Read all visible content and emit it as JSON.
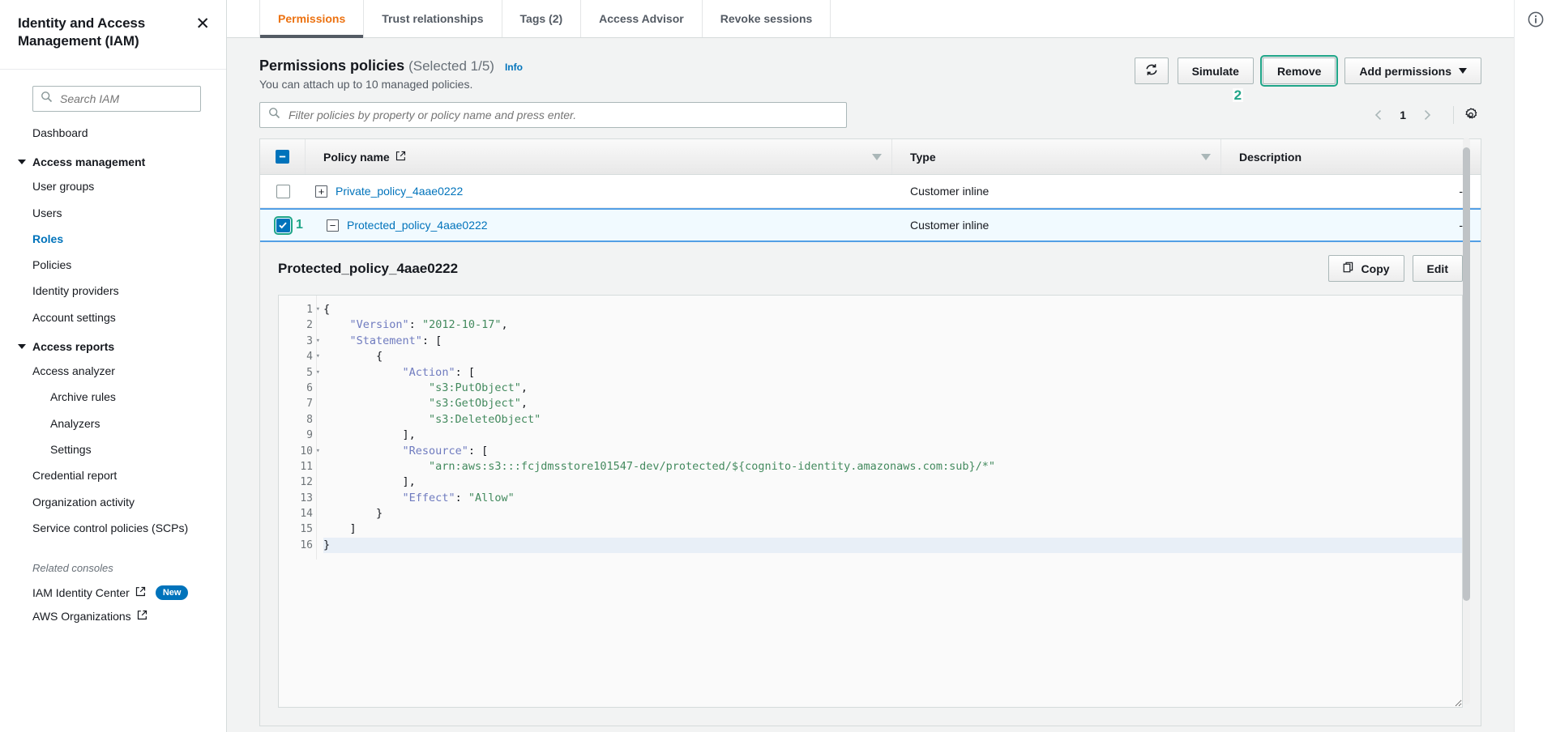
{
  "sidebar": {
    "title": "Identity and Access Management (IAM)",
    "close_label": "✕",
    "search": {
      "placeholder": "Search IAM",
      "value": ""
    },
    "dashboard": "Dashboard",
    "groups": [
      {
        "label": "Access management",
        "items": [
          {
            "label": "User groups",
            "active": false,
            "indent": false
          },
          {
            "label": "Users",
            "active": false,
            "indent": false
          },
          {
            "label": "Roles",
            "active": true,
            "indent": false
          },
          {
            "label": "Policies",
            "active": false,
            "indent": false
          },
          {
            "label": "Identity providers",
            "active": false,
            "indent": false
          },
          {
            "label": "Account settings",
            "active": false,
            "indent": false
          }
        ]
      },
      {
        "label": "Access reports",
        "items": [
          {
            "label": "Access analyzer",
            "active": false,
            "indent": false
          },
          {
            "label": "Archive rules",
            "active": false,
            "indent": true
          },
          {
            "label": "Analyzers",
            "active": false,
            "indent": true
          },
          {
            "label": "Settings",
            "active": false,
            "indent": true
          },
          {
            "label": "Credential report",
            "active": false,
            "indent": false
          },
          {
            "label": "Organization activity",
            "active": false,
            "indent": false
          },
          {
            "label": "Service control policies (SCPs)",
            "active": false,
            "indent": false
          }
        ]
      }
    ],
    "related_label": "Related consoles",
    "related": [
      {
        "label": "IAM Identity Center",
        "badge": "New"
      },
      {
        "label": "AWS Organizations",
        "badge": ""
      }
    ]
  },
  "tabs": [
    {
      "label": "Permissions",
      "active": true
    },
    {
      "label": "Trust relationships",
      "active": false
    },
    {
      "label": "Tags (2)",
      "active": false
    },
    {
      "label": "Access Advisor",
      "active": false
    },
    {
      "label": "Revoke sessions",
      "active": false
    }
  ],
  "panel": {
    "title": "Permissions policies",
    "selected_count": "(Selected 1/5)",
    "info_label": "Info",
    "subtitle": "You can attach up to 10 managed policies.",
    "refresh_icon": "refresh-icon",
    "simulate_label": "Simulate",
    "remove_label": "Remove",
    "add_permissions_label": "Add permissions",
    "step_2": "2"
  },
  "filter": {
    "placeholder": "Filter policies by property or policy name and press enter.",
    "value": ""
  },
  "pagination": {
    "page": "1",
    "prev_icon": "chevron-left-icon",
    "next_icon": "chevron-right-icon",
    "settings_icon": "gear-icon"
  },
  "table": {
    "columns": [
      "Policy name",
      "Type",
      "Description"
    ],
    "rows": [
      {
        "name": "Private_policy_4aae0222",
        "type": "Customer inline",
        "description": "-",
        "selected": false,
        "expanded": false,
        "expander": "+",
        "step": ""
      },
      {
        "name": "Protected_policy_4aae0222",
        "type": "Customer inline",
        "description": "-",
        "selected": true,
        "expanded": true,
        "expander": "−",
        "step": "1"
      }
    ]
  },
  "detail": {
    "title": "Protected_policy_4aae0222",
    "copy_label": "Copy",
    "edit_label": "Edit",
    "code_lines": [
      {
        "n": "1",
        "fold": true,
        "segments": [
          {
            "t": "{",
            "c": "p"
          }
        ]
      },
      {
        "n": "2",
        "fold": false,
        "segments": [
          {
            "t": "    ",
            "c": "p"
          },
          {
            "t": "\"Version\"",
            "c": "k"
          },
          {
            "t": ": ",
            "c": "p"
          },
          {
            "t": "\"2012-10-17\"",
            "c": "s"
          },
          {
            "t": ",",
            "c": "p"
          }
        ]
      },
      {
        "n": "3",
        "fold": true,
        "segments": [
          {
            "t": "    ",
            "c": "p"
          },
          {
            "t": "\"Statement\"",
            "c": "k"
          },
          {
            "t": ": [",
            "c": "p"
          }
        ]
      },
      {
        "n": "4",
        "fold": true,
        "segments": [
          {
            "t": "        {",
            "c": "p"
          }
        ]
      },
      {
        "n": "5",
        "fold": true,
        "segments": [
          {
            "t": "            ",
            "c": "p"
          },
          {
            "t": "\"Action\"",
            "c": "k"
          },
          {
            "t": ": [",
            "c": "p"
          }
        ]
      },
      {
        "n": "6",
        "fold": false,
        "segments": [
          {
            "t": "                ",
            "c": "p"
          },
          {
            "t": "\"s3:PutObject\"",
            "c": "s"
          },
          {
            "t": ",",
            "c": "p"
          }
        ]
      },
      {
        "n": "7",
        "fold": false,
        "segments": [
          {
            "t": "                ",
            "c": "p"
          },
          {
            "t": "\"s3:GetObject\"",
            "c": "s"
          },
          {
            "t": ",",
            "c": "p"
          }
        ]
      },
      {
        "n": "8",
        "fold": false,
        "segments": [
          {
            "t": "                ",
            "c": "p"
          },
          {
            "t": "\"s3:DeleteObject\"",
            "c": "s"
          }
        ]
      },
      {
        "n": "9",
        "fold": false,
        "segments": [
          {
            "t": "            ],",
            "c": "p"
          }
        ]
      },
      {
        "n": "10",
        "fold": true,
        "segments": [
          {
            "t": "            ",
            "c": "p"
          },
          {
            "t": "\"Resource\"",
            "c": "k"
          },
          {
            "t": ": [",
            "c": "p"
          }
        ]
      },
      {
        "n": "11",
        "fold": false,
        "segments": [
          {
            "t": "                ",
            "c": "p"
          },
          {
            "t": "\"arn:aws:s3:::fcjdmsstore101547-dev/protected/${cognito-identity.amazonaws.com:sub}/*\"",
            "c": "s"
          }
        ]
      },
      {
        "n": "12",
        "fold": false,
        "segments": [
          {
            "t": "            ],",
            "c": "p"
          }
        ]
      },
      {
        "n": "13",
        "fold": false,
        "segments": [
          {
            "t": "            ",
            "c": "p"
          },
          {
            "t": "\"Effect\"",
            "c": "k"
          },
          {
            "t": ": ",
            "c": "p"
          },
          {
            "t": "\"Allow\"",
            "c": "s"
          }
        ]
      },
      {
        "n": "14",
        "fold": false,
        "segments": [
          {
            "t": "        }",
            "c": "p"
          }
        ]
      },
      {
        "n": "15",
        "fold": false,
        "segments": [
          {
            "t": "    ]",
            "c": "p"
          }
        ]
      },
      {
        "n": "16",
        "fold": false,
        "hl": true,
        "segments": [
          {
            "t": "}",
            "c": "p"
          }
        ]
      }
    ]
  },
  "rail": {
    "info_icon": "info-icon"
  },
  "colors": {
    "accent_orange": "#ec7211",
    "link_blue": "#0073bb",
    "highlight_teal": "#1fa588",
    "selected_row": "#f1faff",
    "string_green": "#438a5e",
    "key_blue": "#6f7bbf"
  }
}
